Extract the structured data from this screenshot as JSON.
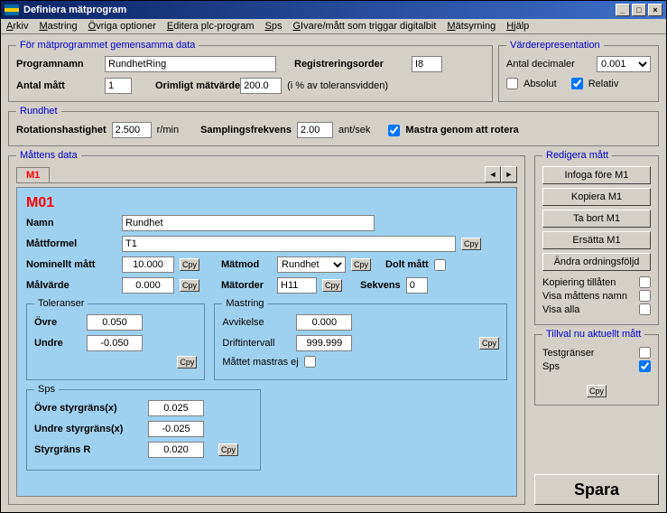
{
  "title": "Definiera mätprogram",
  "menu": [
    "Arkiv",
    "Mastring",
    "Övriga optioner",
    "Editera plc-program",
    "Sps",
    "GIvare/mått som triggar digitalbit",
    "Mätsyrning",
    "Hjälp"
  ],
  "gem": {
    "legend": "För mätprogrammet gemensamma data",
    "programnamn_lbl": "Programnamn",
    "programnamn": "RundhetRing",
    "regorder_lbl": "Registreringsorder",
    "regorder": "I8",
    "antal_lbl": "Antal mått",
    "antal": "1",
    "orimligt_lbl": "Orimligt mätvärde",
    "orimligt": "200.0",
    "orimligt_suffix": "(i % av toleransvidden)"
  },
  "varde": {
    "legend": "Värderepresentation",
    "decimaler_lbl": "Antal decimaler",
    "decimaler": "0.001",
    "absolut": "Absolut",
    "relativ": "Relativ"
  },
  "rundhet": {
    "legend": "Rundhet",
    "rot_lbl": "Rotationshastighet",
    "rot": "2.500",
    "rot_unit": "r/min",
    "samp_lbl": "Samplingsfrekvens",
    "samp": "2.00",
    "samp_unit": "ant/sek",
    "mastra": "Mastra genom att rotera"
  },
  "mattens_legend": "Måttens data",
  "tab": "M1",
  "m": {
    "code": "M01",
    "namn_lbl": "Namn",
    "namn": "Rundhet",
    "formel_lbl": "Måttformel",
    "formel": "T1",
    "nominellt_lbl": "Nominellt mått",
    "nominellt": "10.000",
    "matmod_lbl": "Mätmod",
    "matmod": "Rundhet",
    "dolt_lbl": "Dolt mått",
    "malvarde_lbl": "Målvärde",
    "malvarde": "0.000",
    "matorder_lbl": "Mätorder",
    "matorder": "H11",
    "sekvens_lbl": "Sekvens",
    "sekvens": "0",
    "tol_legend": "Toleranser",
    "ovre_lbl": "Övre",
    "ovre": "0.050",
    "undre_lbl": "Undre",
    "undre": "-0.050",
    "mast_legend": "Mastring",
    "avvikelse_lbl": "Avvikelse",
    "avvikelse": "0.000",
    "drift_lbl": "Driftintervall",
    "drift": "999.999",
    "mastras_lbl": "Måttet mastras ej",
    "sps_legend": "Sps",
    "osg_lbl": "Övre styrgräns(x)",
    "osg": "0.025",
    "usg_lbl": "Undre styrgräns(x)",
    "usg": "-0.025",
    "sgr_lbl": "Styrgräns R",
    "sgr": "0.020"
  },
  "cpy": "Cpy",
  "red": {
    "legend": "Redigera mått",
    "infoga": "Infoga före M1",
    "kopiera": "Kopiera M1",
    "tabort": "Ta bort M1",
    "ersatta": "Ersätta M1",
    "andra": "Ändra ordningsföljd",
    "kop_till": "Kopiering tillåten",
    "visa_namn": "Visa måttens namn",
    "visa_alla": "Visa alla"
  },
  "tillval": {
    "legend": "Tillval nu aktuellt mått",
    "test": "Testgränser",
    "sps": "Sps"
  },
  "spara": "Spara"
}
